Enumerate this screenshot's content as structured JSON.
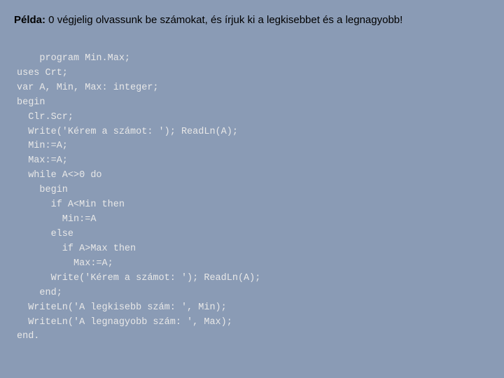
{
  "title": {
    "label_bold": "Példa:",
    "label_rest": " 0 végjelig olvassunk be számokat, és írjuk ki a legkisebbet és a legnagyobb!"
  },
  "code": {
    "lines": [
      "program Min.Max;",
      "uses Crt;",
      "var A, Min, Max: integer;",
      "begin",
      "  Clr.Scr;",
      "  Write('Kérem a számot: '); ReadLn(A);",
      "  Min:=A;",
      "  Max:=A;",
      "  while A<>0 do",
      "    begin",
      "      if A<Min then",
      "        Min:=A",
      "      else",
      "        if A>Max then",
      "          Max:=A;",
      "      Write('Kérem a számot: '); ReadLn(A);",
      "    end;",
      "  WriteLn('A legkisebb szám: ', Min);",
      "  WriteLn('A legnagyobb szám: ', Max);",
      "end."
    ]
  }
}
